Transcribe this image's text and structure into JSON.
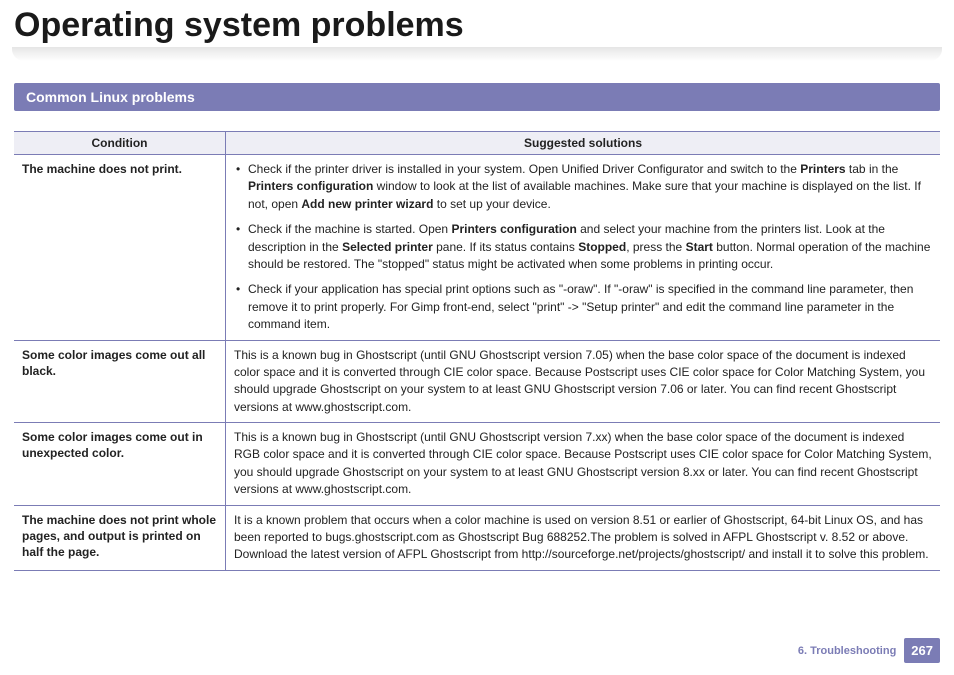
{
  "page": {
    "title": "Operating system problems",
    "section": "Common Linux problems",
    "chapter_label": "6.  Troubleshooting",
    "page_number": "267"
  },
  "table": {
    "headers": {
      "condition": "Condition",
      "solutions": "Suggested solutions"
    },
    "rows": [
      {
        "condition": "The machine does not print.",
        "bullets": [
          {
            "parts": [
              {
                "t": "Check if the printer driver is installed in your system. Open Unified Driver Configurator and switch to the "
              },
              {
                "t": "Printers",
                "b": true
              },
              {
                "t": " tab in the "
              },
              {
                "t": "Printers configuration",
                "b": true
              },
              {
                "t": " window to look at the list of available machines. Make sure that your machine is displayed on the list. If not, open "
              },
              {
                "t": "Add new printer wizard",
                "b": true
              },
              {
                "t": " to set up your device."
              }
            ]
          },
          {
            "parts": [
              {
                "t": "Check if the machine is started. Open "
              },
              {
                "t": "Printers configuration",
                "b": true
              },
              {
                "t": " and select your machine from the printers list. Look at the description in the "
              },
              {
                "t": "Selected printer",
                "b": true
              },
              {
                "t": " pane. If its status contains "
              },
              {
                "t": "Stopped",
                "b": true
              },
              {
                "t": ", press the "
              },
              {
                "t": "Start",
                "b": true
              },
              {
                "t": " button. Normal operation of the machine should be restored. The \"stopped\" status might be activated when some problems in printing occur."
              }
            ]
          },
          {
            "parts": [
              {
                "t": "Check if your application has special print options such as \"-oraw\". If \"-oraw\" is specified in the command line parameter, then remove it to print properly. For Gimp front-end, select \"print\" -> \"Setup printer\" and edit the command line parameter in the command item."
              }
            ]
          }
        ]
      },
      {
        "condition": "Some color images come out all black.",
        "plain": "This is a known bug in Ghostscript (until GNU Ghostscript version 7.05) when the base color space of the document is indexed color space and it is converted through CIE color space. Because Postscript uses CIE color space for Color Matching System, you should upgrade Ghostscript on your system to at least GNU Ghostscript version 7.06 or later. You can find recent Ghostscript versions at www.ghostscript.com."
      },
      {
        "condition": "Some color images come out in unexpected color.",
        "plain": "This is a known bug in Ghostscript (until GNU Ghostscript version 7.xx) when the base color space of the document is indexed RGB color space and it is converted through CIE color space. Because Postscript uses CIE color space for Color Matching System, you should upgrade Ghostscript on your system to at least GNU Ghostscript version 8.xx or later. You can find recent Ghostscript versions at www.ghostscript.com."
      },
      {
        "condition": "The machine does not print whole pages, and output is printed on half the page.",
        "plain": "It is a known problem that occurs when a color machine is used on version 8.51 or earlier of Ghostscript, 64-bit Linux OS, and has been reported to bugs.ghostscript.com as Ghostscript Bug 688252.The problem is solved in AFPL Ghostscript v. 8.52 or above. Download the latest version of AFPL Ghostscript from http://sourceforge.net/projects/ghostscript/ and install it to solve this problem."
      }
    ]
  }
}
